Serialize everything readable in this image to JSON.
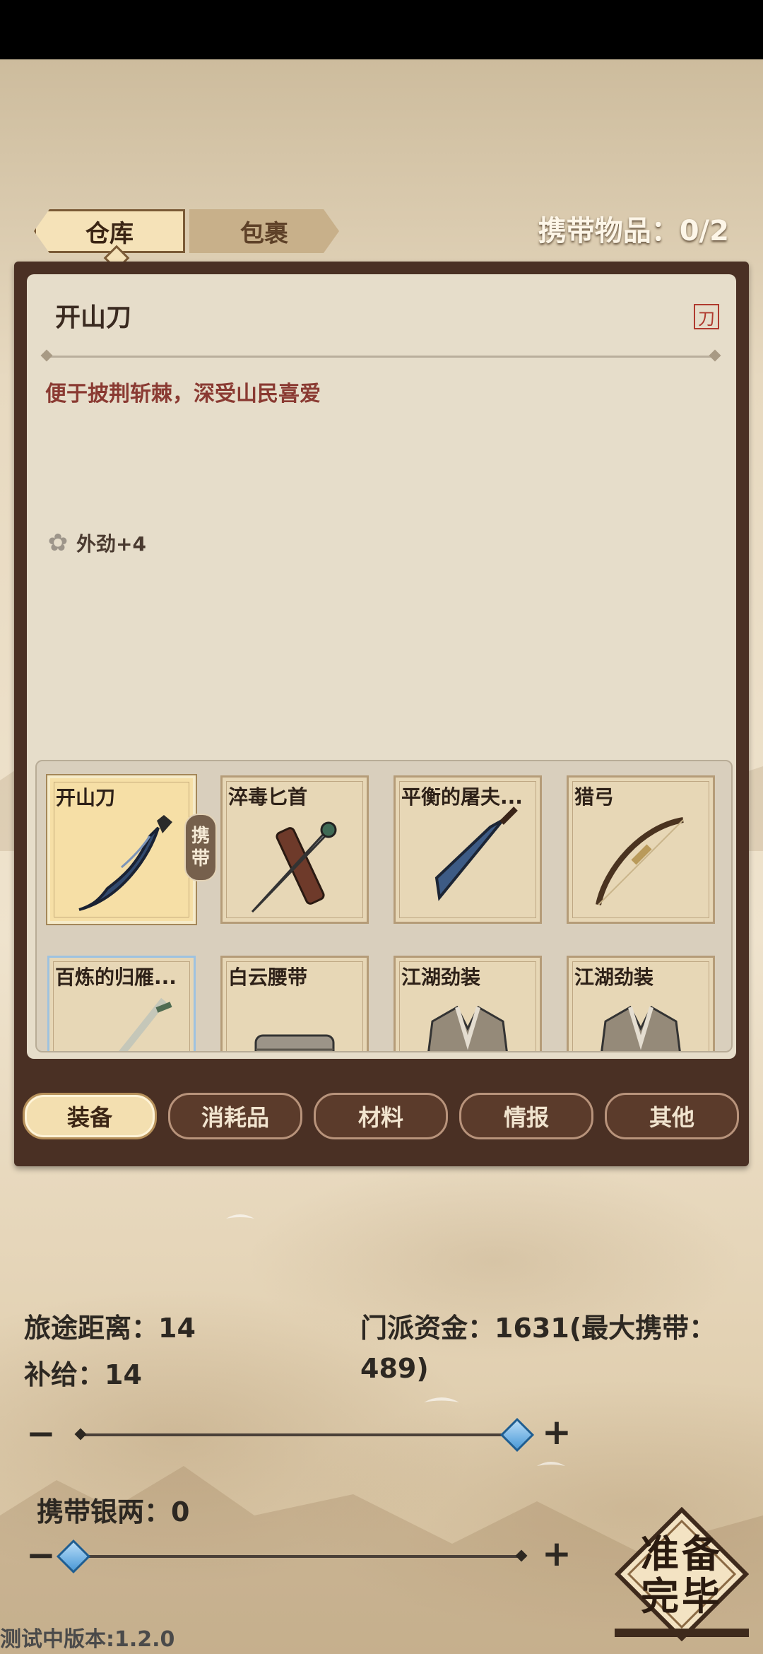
{
  "tabs": {
    "warehouse": "仓库",
    "bag": "包裹"
  },
  "carry_count": "携带物品：0/2",
  "detail": {
    "title": "开山刀",
    "type_tag": "刀",
    "description": "便于披荆斩棘，深受山民喜爱",
    "stat": "外劲+4"
  },
  "items": [
    {
      "name": "开山刀",
      "icon": "machete-icon",
      "selected": true,
      "carried_label": "携带"
    },
    {
      "name": "淬毒匕首",
      "icon": "dagger-icon"
    },
    {
      "name": "平衡的屠夫...",
      "icon": "cleaver-icon"
    },
    {
      "name": "猎弓",
      "icon": "bow-icon"
    },
    {
      "name": "百炼的归雁...",
      "icon": "sword-icon",
      "rarity_color": "#9ec2e0"
    },
    {
      "name": "白云腰带",
      "icon": "belt-icon"
    },
    {
      "name": "江湖劲装",
      "icon": "robe-icon"
    },
    {
      "name": "江湖劲装",
      "icon": "robe-icon"
    }
  ],
  "categories": [
    {
      "label": "装备",
      "active": true
    },
    {
      "label": "消耗品",
      "active": false
    },
    {
      "label": "材料",
      "active": false
    },
    {
      "label": "情报",
      "active": false
    },
    {
      "label": "其他",
      "active": false
    }
  ],
  "journey": {
    "distance": "旅途距离：14",
    "supply": "补给：14",
    "funds_line1": "门派资金：1631(最大携带：",
    "funds_line2": "489)"
  },
  "supply_slider": {
    "value_fraction": 1.0,
    "minus": "−",
    "plus": "+"
  },
  "silver": {
    "label": "携带银两：0",
    "value_fraction": 0.0,
    "minus": "−",
    "plus": "+"
  },
  "ready_button": {
    "line1": "准备",
    "line2": "完毕"
  },
  "version": "测试中版本:1.2.0",
  "colors": {
    "accent_blue": "#4b9ad8",
    "panel_brown": "#4a3024",
    "desc_red": "#8a3a32"
  }
}
